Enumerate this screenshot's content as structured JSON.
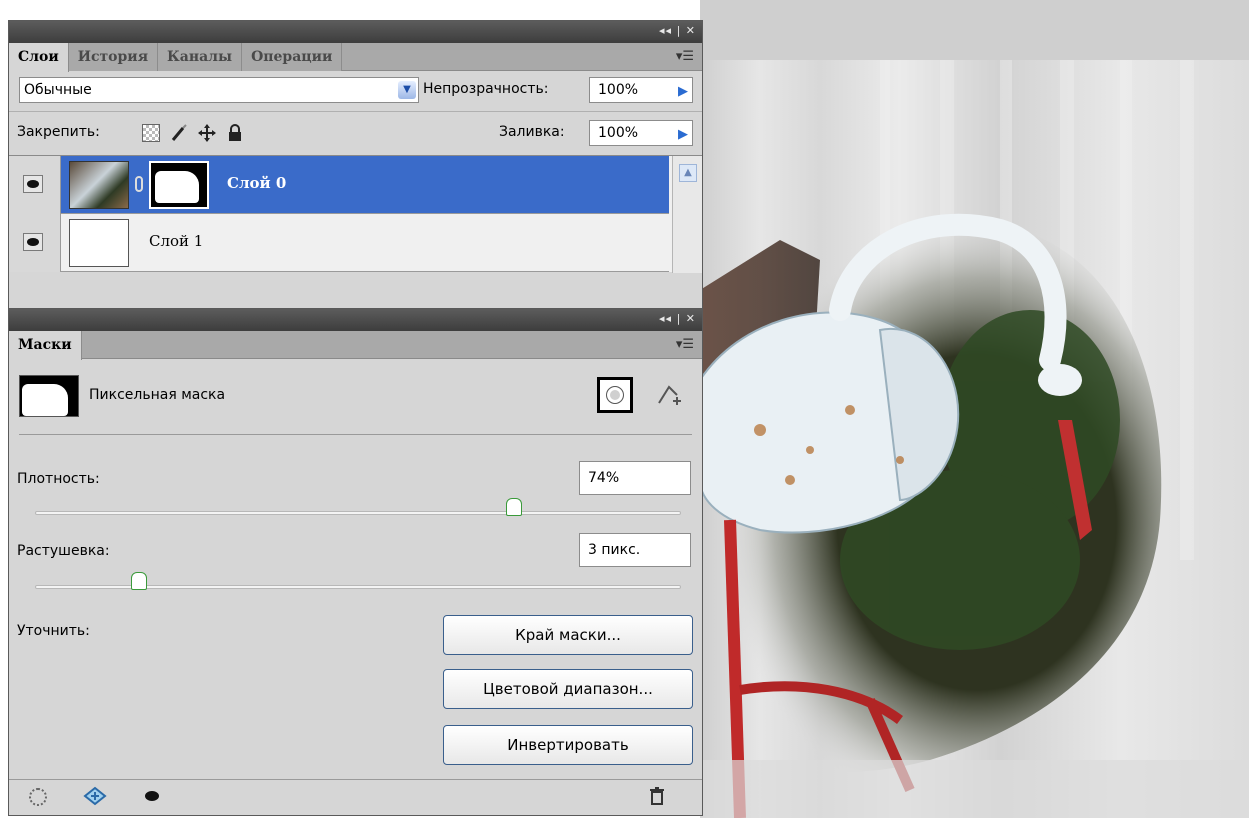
{
  "layers_panel": {
    "tabs": [
      {
        "label": "Слои",
        "active": true
      },
      {
        "label": "История",
        "active": false
      },
      {
        "label": "Каналы",
        "active": false
      },
      {
        "label": "Операции",
        "active": false
      }
    ],
    "window_controls": "◂◂ | ✕",
    "blend_mode": "Обычные",
    "opacity_label": "Непрозрачность:",
    "opacity_value": "100%",
    "lock_label": "Закрепить:",
    "fill_label": "Заливка:",
    "fill_value": "100%",
    "layers": [
      {
        "name": "Слой 0",
        "selected": true
      },
      {
        "name": "Слой 1",
        "selected": false
      }
    ]
  },
  "masks_panel": {
    "tabs": [
      {
        "label": "Маски",
        "active": true
      }
    ],
    "window_controls": "◂◂ | ✕",
    "mask_type": "Пиксельная маска",
    "density_label": "Плотность:",
    "density_value": "74%",
    "density_level": 0.74,
    "feather_label": "Растушевка:",
    "feather_value": "3 пикс.",
    "feather_level": 0.16,
    "refine_label": "Уточнить:",
    "buttons": {
      "mask_edge": "Край маски...",
      "color_range": "Цветовой диапазон...",
      "invert": "Инвертировать"
    }
  },
  "colors": {
    "selection": "#3a6bc9",
    "panel_bg": "#d6d6d6",
    "titlebar": "#3d3d3d"
  }
}
